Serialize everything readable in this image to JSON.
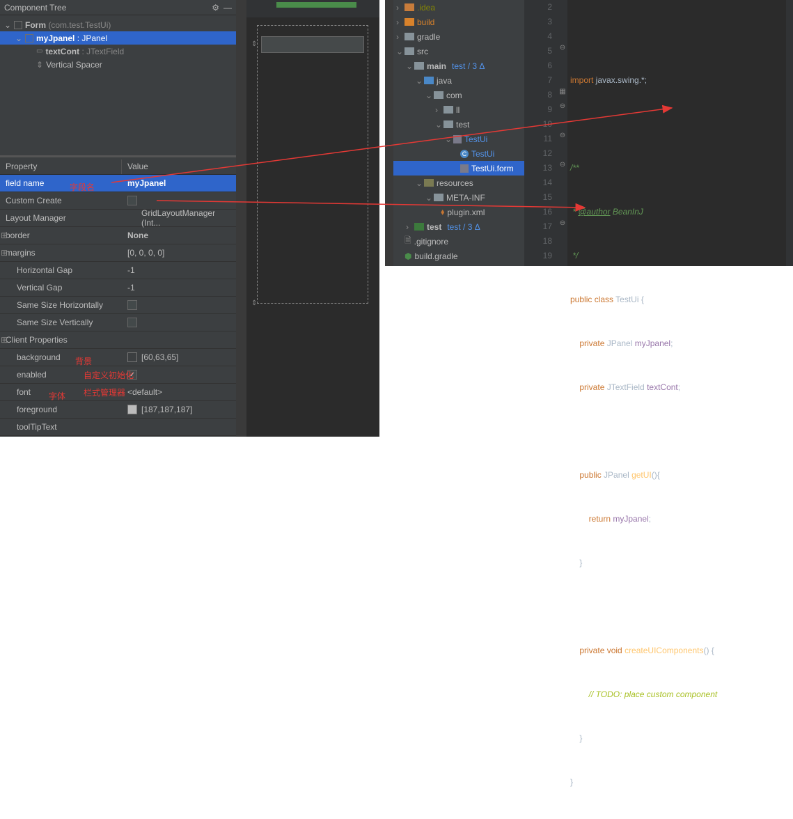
{
  "componentTree": {
    "title": "Component Tree",
    "items": [
      {
        "label": "Form",
        "suffix": "(com.test.TestUi)"
      },
      {
        "label": "myJpanel",
        "suffix": ": JPanel"
      },
      {
        "label": "textCont",
        "suffix": ": JTextField"
      },
      {
        "label": "Vertical Spacer"
      }
    ]
  },
  "propertyPanel": {
    "headerKey": "Property",
    "headerVal": "Value",
    "rows": {
      "fieldName": {
        "k": "field name",
        "v": "myJpanel",
        "annot": "字段名"
      },
      "customCreate": {
        "k": "Custom Create",
        "annot": "自定义初始化"
      },
      "layoutManager": {
        "k": "Layout Manager",
        "v": "GridLayoutManager (Int...",
        "annot": "栏式管理器"
      },
      "border": {
        "k": "border",
        "v": "None"
      },
      "margins": {
        "k": "margins",
        "v": "[0, 0, 0, 0]"
      },
      "hgap": {
        "k": "Horizontal Gap",
        "v": "-1"
      },
      "vgap": {
        "k": "Vertical Gap",
        "v": "-1"
      },
      "ssh": {
        "k": "Same Size Horizontally"
      },
      "ssv": {
        "k": "Same Size Vertically"
      },
      "clientProps": {
        "k": "Client Properties"
      },
      "background": {
        "k": "background",
        "v": "[60,63,65]",
        "annot": "背景"
      },
      "enabled": {
        "k": "enabled"
      },
      "font": {
        "k": "font",
        "v": "<default>",
        "annot": "字体"
      },
      "foreground": {
        "k": "foreground",
        "v": "[187,187,187]"
      },
      "toolTip": {
        "k": "toolTipText"
      }
    }
  },
  "projectTree": {
    "items": [
      {
        "label": ".idea",
        "color": "orange"
      },
      {
        "label": "build",
        "color": "orange-lit"
      },
      {
        "label": "gradle"
      },
      {
        "label": "src"
      },
      {
        "label": "main",
        "suffix": " test / 3 Δ",
        "bold": true
      },
      {
        "label": "java"
      },
      {
        "label": "com"
      },
      {
        "label": "ll"
      },
      {
        "label": "test"
      },
      {
        "label": "TestUi",
        "class": true,
        "blue": true
      },
      {
        "label": "TestUi",
        "subclass": true
      },
      {
        "label": "TestUi.form",
        "form": true,
        "sel": true
      },
      {
        "label": "resources"
      },
      {
        "label": "META-INF"
      },
      {
        "label": "plugin.xml"
      },
      {
        "label": "test",
        "suffix": " test / 3 Δ",
        "bold": true
      },
      {
        "label": ".gitignore"
      },
      {
        "label": "build.gradle"
      }
    ]
  },
  "code": {
    "lines": [
      "",
      "import javax.swing.*;",
      "",
      "/**",
      " * @author BeanInJ",
      " */",
      "public class TestUi {",
      "    private JPanel myJpanel;",
      "    private JTextField textCont;",
      "",
      "    public JPanel getUI(){",
      "        return myJpanel;",
      "    }",
      "",
      "    private void createUIComponents() {",
      "        // TODO: place custom component ",
      "    }",
      "}"
    ],
    "lineNumbers": [
      "2",
      "3",
      "4",
      "5",
      "6",
      "7",
      "8",
      "9",
      "10",
      "11",
      "12",
      "13",
      "14",
      "15",
      "16",
      "17",
      "18",
      "19"
    ]
  }
}
